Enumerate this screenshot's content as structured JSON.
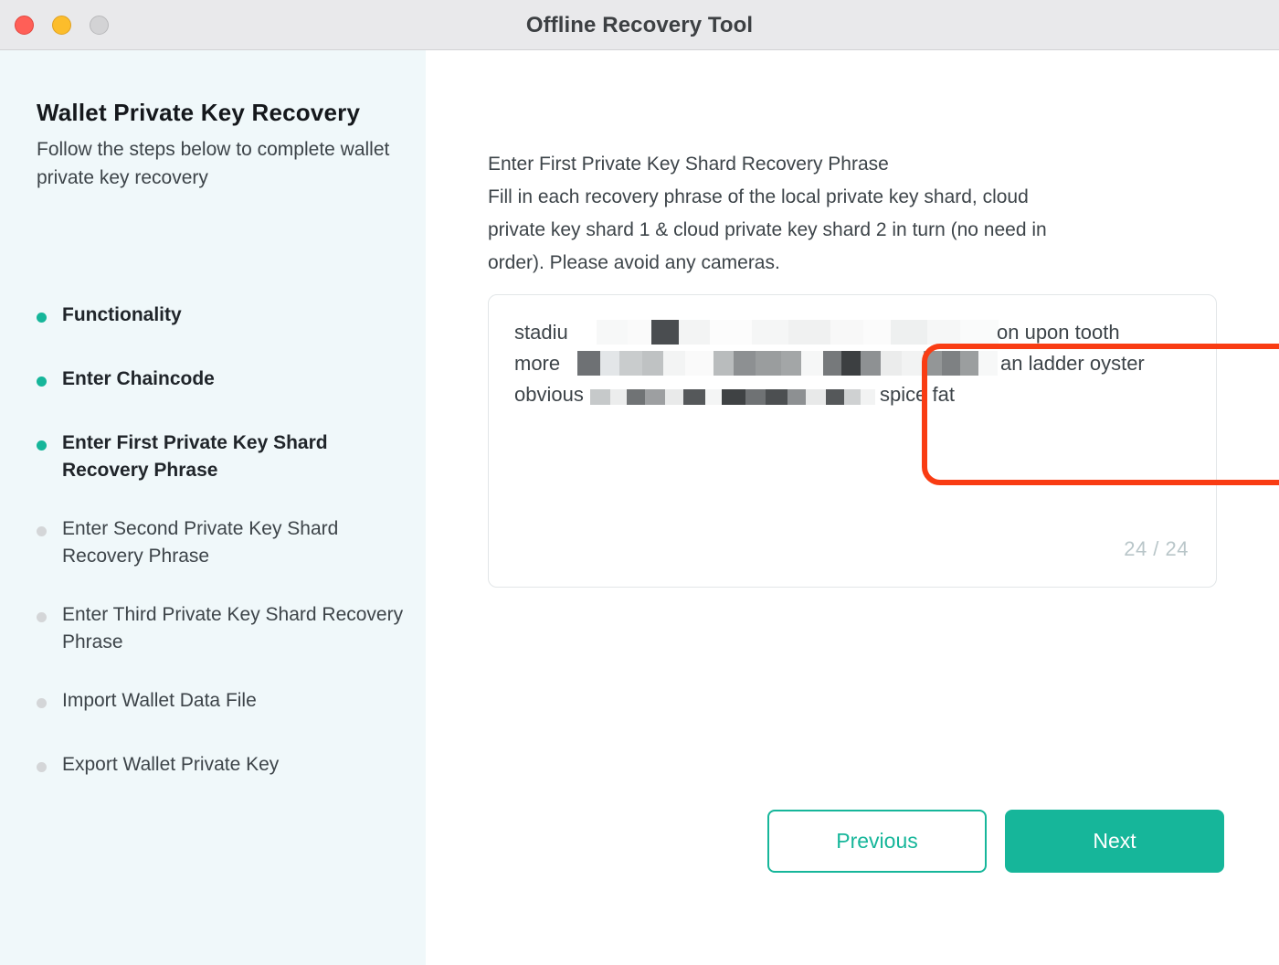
{
  "window": {
    "title": "Offline Recovery Tool",
    "controls": [
      {
        "name": "close-button",
        "color": "#ff5f57"
      },
      {
        "name": "minimize-button",
        "color": "#fcbd2b"
      },
      {
        "name": "maximize-button",
        "color": "#d3d3d5"
      }
    ]
  },
  "sidebar": {
    "title": "Wallet Private Key Recovery",
    "subtitle": "Follow the steps below to complete wallet private key recovery",
    "active_color": "#16b69a",
    "inactive_color": "#d4d6d8",
    "steps": [
      {
        "label": "Functionality",
        "state": "done"
      },
      {
        "label": "Enter Chaincode",
        "state": "done"
      },
      {
        "label": "Enter First Private Key Shard Recovery Phrase",
        "state": "active"
      },
      {
        "label": "Enter Second Private Key Shard Recovery Phrase",
        "state": "pending"
      },
      {
        "label": "Enter Third Private Key Shard Recovery Phrase",
        "state": "pending"
      },
      {
        "label": "Import Wallet Data File",
        "state": "pending"
      },
      {
        "label": "Export Wallet Private Key",
        "state": "pending"
      }
    ]
  },
  "main": {
    "heading": "Enter First Private Key Shard Recovery Phrase",
    "description_lines": [
      "Fill in each recovery phrase of the local private key shard, cloud",
      "private key shard 1 & cloud private key shard 2 in turn (no need in",
      "order). Please avoid any cameras."
    ],
    "phrase_field": {
      "lines": [
        {
          "prefix": "stadiu",
          "suffix": "on upon tooth"
        },
        {
          "prefix": "more",
          "suffix": "an ladder oyster"
        },
        {
          "prefix": "obvious",
          "suffix": "spice fat"
        }
      ],
      "counter": "24 / 24",
      "counter_color": "#b9c6c9"
    },
    "annotation": {
      "shape": "rounded-rectangle",
      "color": "#f93c13"
    },
    "buttons": {
      "previous": "Previous",
      "next": "Next",
      "accent_color": "#16b69a"
    }
  }
}
